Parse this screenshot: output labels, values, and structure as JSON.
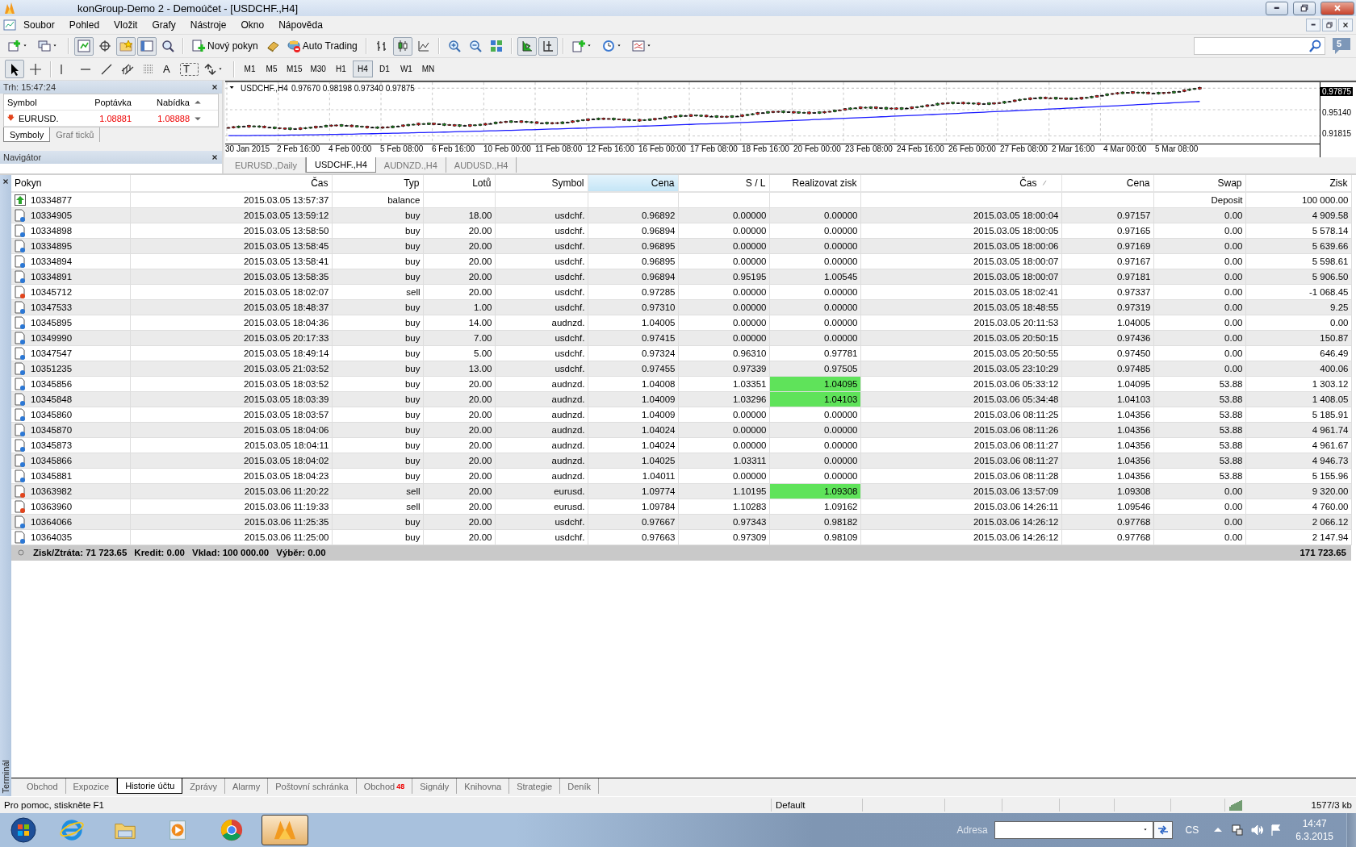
{
  "window": {
    "title": "konGroup-Demo 2 - Demoúčet - [USDCHF.,H4]"
  },
  "menu": [
    "Soubor",
    "Pohled",
    "Vložit",
    "Grafy",
    "Nástroje",
    "Okno",
    "Nápověda"
  ],
  "toolbar": {
    "new_order": "Nový pokyn",
    "auto_trading": "Auto Trading",
    "chat_badge": "5"
  },
  "drawing_tools": {
    "text": "A",
    "label": "T"
  },
  "timeframes": [
    {
      "label": "M1",
      "selected": false
    },
    {
      "label": "M5",
      "selected": false
    },
    {
      "label": "M15",
      "selected": false
    },
    {
      "label": "M30",
      "selected": false
    },
    {
      "label": "H1",
      "selected": false
    },
    {
      "label": "H4",
      "selected": true
    },
    {
      "label": "D1",
      "selected": false
    },
    {
      "label": "W1",
      "selected": false
    },
    {
      "label": "MN",
      "selected": false
    }
  ],
  "market_watch": {
    "title": "Trh: 15:47:24",
    "columns": [
      "Symbol",
      "Poptávka",
      "Nabídka"
    ],
    "rows": [
      {
        "symbol": "EURUSD.",
        "bid": "1.08881",
        "ask": "1.08888",
        "tick_down": true
      }
    ],
    "tabs": [
      {
        "label": "Symboly",
        "selected": true
      },
      {
        "label": "Graf ticků",
        "selected": false
      }
    ]
  },
  "navigator": {
    "title": "Navigátor"
  },
  "chart": {
    "symbol": "USDCHF.,H4",
    "ohlc": "0.97670 0.98198 0.97340 0.97875",
    "price_labels": [
      {
        "label": "0.97875",
        "current": true
      },
      {
        "label": "0.95140",
        "current": false
      },
      {
        "label": "0.91815",
        "current": false
      }
    ],
    "time_labels": [
      "30 Jan 2015",
      "2 Feb 16:00",
      "4 Feb 00:00",
      "5 Feb 08:00",
      "6 Feb 16:00",
      "10 Feb 00:00",
      "11 Feb 08:00",
      "12 Feb 16:00",
      "16 Feb 00:00",
      "17 Feb 08:00",
      "18 Feb 16:00",
      "20 Feb 00:00",
      "23 Feb 08:00",
      "24 Feb 16:00",
      "26 Feb 00:00",
      "27 Feb 08:00",
      "2 Mar 16:00",
      "4 Mar 00:00",
      "5 Mar 08:00"
    ]
  },
  "chart_tabs": [
    {
      "label": "EURUSD.,Daily",
      "selected": false
    },
    {
      "label": "USDCHF.,H4",
      "selected": true
    },
    {
      "label": "AUDNZD.,H4",
      "selected": false
    },
    {
      "label": "AUDUSD.,H4",
      "selected": false
    }
  ],
  "terminal": {
    "title": "Terminál",
    "columns": [
      {
        "label": "Pokyn",
        "selected": false,
        "sorted": false
      },
      {
        "label": "Čas",
        "selected": false,
        "sorted": false
      },
      {
        "label": "Typ",
        "selected": false,
        "sorted": false
      },
      {
        "label": "Lotů",
        "selected": false,
        "sorted": false
      },
      {
        "label": "Symbol",
        "selected": false,
        "sorted": false
      },
      {
        "label": "Cena",
        "selected": true,
        "sorted": false
      },
      {
        "label": "S / L",
        "selected": false,
        "sorted": false
      },
      {
        "label": "Realizovat zisk",
        "selected": false,
        "sorted": false
      },
      {
        "label": "Čas",
        "selected": false,
        "sorted": true
      },
      {
        "label": "Cena",
        "selected": false,
        "sorted": false
      },
      {
        "label": "Swap",
        "selected": false,
        "sorted": false
      },
      {
        "label": "Zisk",
        "selected": false,
        "sorted": false
      }
    ],
    "rows": [
      {
        "kind": "balance",
        "ticket": "10334877",
        "open_time": "2015.03.05 13:57:37",
        "type": "balance",
        "swap": "Deposit",
        "profit": "100 000.00"
      },
      {
        "kind": "buy",
        "ticket": "10334905",
        "open_time": "2015.03.05 13:59:12",
        "type": "buy",
        "lots": "18.00",
        "symbol": "usdchf.",
        "open_price": "0.96892",
        "sl": "0.00000",
        "tp": "0.00000",
        "close_time": "2015.03.05 18:00:04",
        "close_price": "0.97157",
        "swap": "0.00",
        "profit": "4 909.58"
      },
      {
        "kind": "buy",
        "ticket": "10334898",
        "open_time": "2015.03.05 13:58:50",
        "type": "buy",
        "lots": "20.00",
        "symbol": "usdchf.",
        "open_price": "0.96894",
        "sl": "0.00000",
        "tp": "0.00000",
        "close_time": "2015.03.05 18:00:05",
        "close_price": "0.97165",
        "swap": "0.00",
        "profit": "5 578.14"
      },
      {
        "kind": "buy",
        "ticket": "10334895",
        "open_time": "2015.03.05 13:58:45",
        "type": "buy",
        "lots": "20.00",
        "symbol": "usdchf.",
        "open_price": "0.96895",
        "sl": "0.00000",
        "tp": "0.00000",
        "close_time": "2015.03.05 18:00:06",
        "close_price": "0.97169",
        "swap": "0.00",
        "profit": "5 639.66"
      },
      {
        "kind": "buy",
        "ticket": "10334894",
        "open_time": "2015.03.05 13:58:41",
        "type": "buy",
        "lots": "20.00",
        "symbol": "usdchf.",
        "open_price": "0.96895",
        "sl": "0.00000",
        "tp": "0.00000",
        "close_time": "2015.03.05 18:00:07",
        "close_price": "0.97167",
        "swap": "0.00",
        "profit": "5 598.61"
      },
      {
        "kind": "buy",
        "ticket": "10334891",
        "open_time": "2015.03.05 13:58:35",
        "type": "buy",
        "lots": "20.00",
        "symbol": "usdchf.",
        "open_price": "0.96894",
        "sl": "0.95195",
        "tp": "1.00545",
        "close_time": "2015.03.05 18:00:07",
        "close_price": "0.97181",
        "swap": "0.00",
        "profit": "5 906.50"
      },
      {
        "kind": "sell",
        "ticket": "10345712",
        "open_time": "2015.03.05 18:02:07",
        "type": "sell",
        "lots": "20.00",
        "symbol": "usdchf.",
        "open_price": "0.97285",
        "sl": "0.00000",
        "tp": "0.00000",
        "close_time": "2015.03.05 18:02:41",
        "close_price": "0.97337",
        "swap": "0.00",
        "profit": "-1 068.45"
      },
      {
        "kind": "buy",
        "ticket": "10347533",
        "open_time": "2015.03.05 18:48:37",
        "type": "buy",
        "lots": "1.00",
        "symbol": "usdchf.",
        "open_price": "0.97310",
        "sl": "0.00000",
        "tp": "0.00000",
        "close_time": "2015.03.05 18:48:55",
        "close_price": "0.97319",
        "swap": "0.00",
        "profit": "9.25"
      },
      {
        "kind": "buy",
        "ticket": "10345895",
        "open_time": "2015.03.05 18:04:36",
        "type": "buy",
        "lots": "14.00",
        "symbol": "audnzd.",
        "open_price": "1.04005",
        "sl": "0.00000",
        "tp": "0.00000",
        "close_time": "2015.03.05 20:11:53",
        "close_price": "1.04005",
        "swap": "0.00",
        "profit": "0.00"
      },
      {
        "kind": "buy",
        "ticket": "10349990",
        "open_time": "2015.03.05 20:17:33",
        "type": "buy",
        "lots": "7.00",
        "symbol": "usdchf.",
        "open_price": "0.97415",
        "sl": "0.00000",
        "tp": "0.00000",
        "close_time": "2015.03.05 20:50:15",
        "close_price": "0.97436",
        "swap": "0.00",
        "profit": "150.87"
      },
      {
        "kind": "buy",
        "ticket": "10347547",
        "open_time": "2015.03.05 18:49:14",
        "type": "buy",
        "lots": "5.00",
        "symbol": "usdchf.",
        "open_price": "0.97324",
        "sl": "0.96310",
        "tp": "0.97781",
        "close_time": "2015.03.05 20:50:55",
        "close_price": "0.97450",
        "swap": "0.00",
        "profit": "646.49"
      },
      {
        "kind": "buy",
        "ticket": "10351235",
        "open_time": "2015.03.05 21:03:52",
        "type": "buy",
        "lots": "13.00",
        "symbol": "usdchf.",
        "open_price": "0.97455",
        "sl": "0.97339",
        "tp": "0.97505",
        "close_time": "2015.03.05 23:10:29",
        "close_price": "0.97485",
        "swap": "0.00",
        "profit": "400.06"
      },
      {
        "kind": "buy",
        "ticket": "10345856",
        "open_time": "2015.03.05 18:03:52",
        "type": "buy",
        "lots": "20.00",
        "symbol": "audnzd.",
        "open_price": "1.04008",
        "sl": "1.03351",
        "tp": "1.04095",
        "close_time": "2015.03.06 05:33:12",
        "close_price": "1.04095",
        "swap": "53.88",
        "profit": "1 303.12",
        "tp_hit": true
      },
      {
        "kind": "buy",
        "ticket": "10345848",
        "open_time": "2015.03.05 18:03:39",
        "type": "buy",
        "lots": "20.00",
        "symbol": "audnzd.",
        "open_price": "1.04009",
        "sl": "1.03296",
        "tp": "1.04103",
        "close_time": "2015.03.06 05:34:48",
        "close_price": "1.04103",
        "swap": "53.88",
        "profit": "1 408.05",
        "tp_hit": true
      },
      {
        "kind": "buy",
        "ticket": "10345860",
        "open_time": "2015.03.05 18:03:57",
        "type": "buy",
        "lots": "20.00",
        "symbol": "audnzd.",
        "open_price": "1.04009",
        "sl": "0.00000",
        "tp": "0.00000",
        "close_time": "2015.03.06 08:11:25",
        "close_price": "1.04356",
        "swap": "53.88",
        "profit": "5 185.91"
      },
      {
        "kind": "buy",
        "ticket": "10345870",
        "open_time": "2015.03.05 18:04:06",
        "type": "buy",
        "lots": "20.00",
        "symbol": "audnzd.",
        "open_price": "1.04024",
        "sl": "0.00000",
        "tp": "0.00000",
        "close_time": "2015.03.06 08:11:26",
        "close_price": "1.04356",
        "swap": "53.88",
        "profit": "4 961.74"
      },
      {
        "kind": "buy",
        "ticket": "10345873",
        "open_time": "2015.03.05 18:04:11",
        "type": "buy",
        "lots": "20.00",
        "symbol": "audnzd.",
        "open_price": "1.04024",
        "sl": "0.00000",
        "tp": "0.00000",
        "close_time": "2015.03.06 08:11:27",
        "close_price": "1.04356",
        "swap": "53.88",
        "profit": "4 961.67"
      },
      {
        "kind": "buy",
        "ticket": "10345866",
        "open_time": "2015.03.05 18:04:02",
        "type": "buy",
        "lots": "20.00",
        "symbol": "audnzd.",
        "open_price": "1.04025",
        "sl": "1.03311",
        "tp": "0.00000",
        "close_time": "2015.03.06 08:11:27",
        "close_price": "1.04356",
        "swap": "53.88",
        "profit": "4 946.73"
      },
      {
        "kind": "buy",
        "ticket": "10345881",
        "open_time": "2015.03.05 18:04:23",
        "type": "buy",
        "lots": "20.00",
        "symbol": "audnzd.",
        "open_price": "1.04011",
        "sl": "0.00000",
        "tp": "0.00000",
        "close_time": "2015.03.06 08:11:28",
        "close_price": "1.04356",
        "swap": "53.88",
        "profit": "5 155.96"
      },
      {
        "kind": "sell",
        "ticket": "10363982",
        "open_time": "2015.03.06 11:20:22",
        "type": "sell",
        "lots": "20.00",
        "symbol": "eurusd.",
        "open_price": "1.09774",
        "sl": "1.10195",
        "tp": "1.09308",
        "close_time": "2015.03.06 13:57:09",
        "close_price": "1.09308",
        "swap": "0.00",
        "profit": "9 320.00",
        "tp_hit": true
      },
      {
        "kind": "sell",
        "ticket": "10363960",
        "open_time": "2015.03.06 11:19:33",
        "type": "sell",
        "lots": "20.00",
        "symbol": "eurusd.",
        "open_price": "1.09784",
        "sl": "1.10283",
        "tp": "1.09162",
        "close_time": "2015.03.06 14:26:11",
        "close_price": "1.09546",
        "swap": "0.00",
        "profit": "4 760.00"
      },
      {
        "kind": "buy",
        "ticket": "10364066",
        "open_time": "2015.03.06 11:25:35",
        "type": "buy",
        "lots": "20.00",
        "symbol": "usdchf.",
        "open_price": "0.97667",
        "sl": "0.97343",
        "tp": "0.98182",
        "close_time": "2015.03.06 14:26:12",
        "close_price": "0.97768",
        "swap": "0.00",
        "profit": "2 066.12"
      },
      {
        "kind": "buy",
        "ticket": "10364035",
        "open_time": "2015.03.06 11:25:00",
        "type": "buy",
        "lots": "20.00",
        "symbol": "usdchf.",
        "open_price": "0.97663",
        "sl": "0.97309",
        "tp": "0.98109",
        "close_time": "2015.03.06 14:26:12",
        "close_price": "0.97768",
        "swap": "0.00",
        "profit": "2 147.94"
      }
    ],
    "summary": [
      "Zisk/Ztráta: 71 723.65",
      "Kredit: 0.00",
      "Vklad: 100 000.00",
      "Výběr: 0.00"
    ],
    "total": "171 723.65",
    "tabs": [
      {
        "label": "Obchod",
        "selected": false
      },
      {
        "label": "Expozice",
        "selected": false
      },
      {
        "label": "Historie účtu",
        "selected": true
      },
      {
        "label": "Zprávy",
        "selected": false
      },
      {
        "label": "Alarmy",
        "selected": false
      },
      {
        "label": "Poštovní schránka",
        "selected": false
      },
      {
        "label": "Obchod",
        "badge": "48",
        "selected": false
      },
      {
        "label": "Signály",
        "selected": false
      },
      {
        "label": "Knihovna",
        "selected": false
      },
      {
        "label": "Strategie",
        "selected": false
      },
      {
        "label": "Deník",
        "selected": false
      }
    ]
  },
  "status_bar": {
    "help": "Pro pomoc, stiskněte F1",
    "profile": "Default",
    "traffic": "1577/3 kb"
  },
  "taskbar": {
    "apps": [
      {
        "kind": "ie",
        "selected": false
      },
      {
        "kind": "folder",
        "selected": false
      },
      {
        "kind": "media",
        "selected": false
      },
      {
        "kind": "chrome",
        "selected": false
      },
      {
        "kind": "mt4",
        "selected": true
      }
    ],
    "address_label": "Adresa",
    "language": "CS",
    "time": "14:47",
    "date": "6.3.2015"
  }
}
